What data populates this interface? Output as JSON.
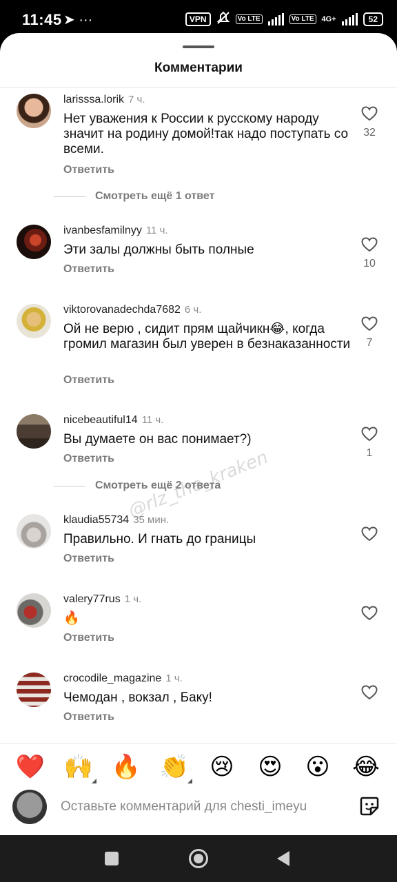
{
  "status_bar": {
    "time": "11:45",
    "left_icons": "➤ ···",
    "vpn": "VPN",
    "volte1": "Vo LTE",
    "volte2": "Vo LTE",
    "network": "4G+",
    "battery": "52"
  },
  "sheet": {
    "title": "Комментарии"
  },
  "comments": [
    {
      "username": "larisssa.lorik",
      "time": "7 ч.",
      "text": "Нет уважения к России к русскому народу значит на родину домой!так надо поступать со всеми.",
      "reply_label": "Ответить",
      "likes": "32"
    },
    {
      "username": "ivanbesfamilnyy",
      "time": "11 ч.",
      "text": "Эти залы должны быть полные",
      "reply_label": "Ответить",
      "likes": "10"
    },
    {
      "username": "viktorovanadechda7682",
      "time": "6 ч.",
      "text": "Ой не верю , сидит прям щайчикн😂, когда громил магазин был уверен в безнаказанности",
      "reply_label": "Ответить",
      "likes": "7"
    },
    {
      "username": "nicebeautiful14",
      "time": "11 ч.",
      "text": "Вы думаете он вас понимает?)",
      "reply_label": "Ответить",
      "likes": "1"
    },
    {
      "username": "klaudia55734",
      "time": "35 мин.",
      "text": "Правильно. И гнать до границы",
      "reply_label": "Ответить",
      "likes": ""
    },
    {
      "username": "valery77rus",
      "time": "1 ч.",
      "text": "🔥",
      "reply_label": "Ответить",
      "likes": ""
    },
    {
      "username": "crocodile_magazine",
      "time": "1 ч.",
      "text": "Чемодан , вокзал , Баку!",
      "reply_label": "Ответить",
      "likes": ""
    }
  ],
  "more_replies": [
    {
      "label": "Смотреть ещё 1 ответ"
    },
    {
      "label": "Смотреть ещё 2 ответа"
    }
  ],
  "watermark": "@rlz_the_kraken",
  "reactions": [
    "❤️",
    "🙌",
    "🔥",
    "👏",
    "😢",
    "😍",
    "😮",
    "😂"
  ],
  "input": {
    "placeholder": "Оставьте комментарий для chesti_imeyu"
  },
  "icons": {
    "like": "heart-outline-icon",
    "sticker": "sticker-icon",
    "nav_recents": "square-icon",
    "nav_home": "circle-icon",
    "nav_back": "triangle-back-icon"
  }
}
